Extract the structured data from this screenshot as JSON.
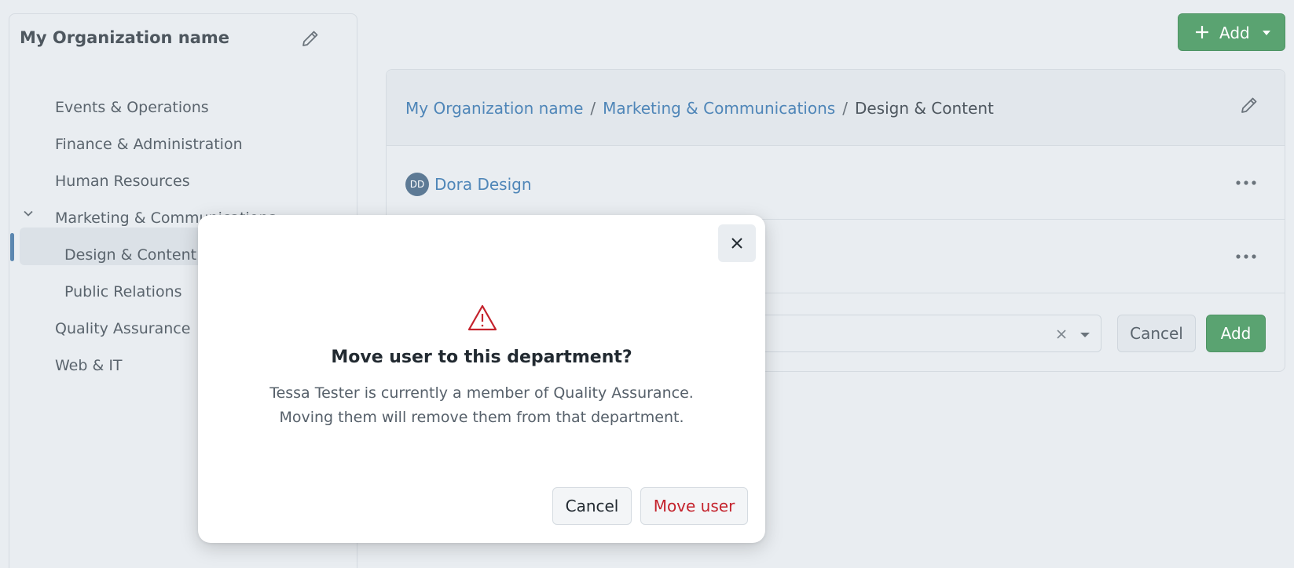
{
  "sidebar": {
    "org_name": "My Organization name",
    "items": [
      {
        "label": "Events & Operations"
      },
      {
        "label": "Finance & Administration"
      },
      {
        "label": "Human Resources"
      },
      {
        "label": "Marketing & Communications",
        "expanded": true
      },
      {
        "label": "Design & Content",
        "active": true
      },
      {
        "label": "Public Relations"
      },
      {
        "label": "Quality Assurance"
      },
      {
        "label": "Web & IT"
      }
    ]
  },
  "header": {
    "add_label": "Add"
  },
  "breadcrumb": {
    "root": "My Organization name",
    "parent": "Marketing & Communications",
    "current": "Design & Content",
    "separator": "/"
  },
  "members": [
    {
      "initials": "DD",
      "name": "Dora Design"
    }
  ],
  "add_row": {
    "cancel_label": "Cancel",
    "add_label": "Add"
  },
  "modal": {
    "title": "Move user to this department?",
    "body_line1": "Tessa Tester is currently a member of Quality Assurance.",
    "body_line2": "Moving them will remove them from that department.",
    "cancel_label": "Cancel",
    "confirm_label": "Move user"
  },
  "colors": {
    "accent": "#5aa371",
    "link": "#4f86b8",
    "danger": "#c4222c"
  }
}
